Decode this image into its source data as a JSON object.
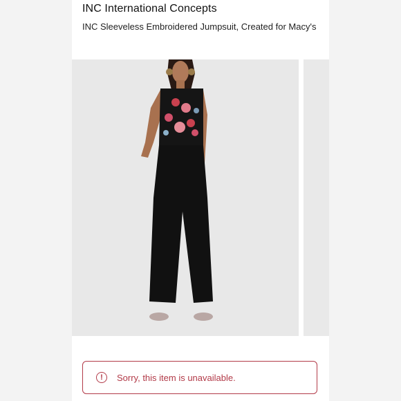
{
  "product": {
    "brand": "INC International Concepts",
    "title": "INC Sleeveless Embroidered Jumpsuit, Created for Macy's"
  },
  "gallery": {
    "image_description_icon": "product-photo-jumpsuit"
  },
  "notice": {
    "icon": "alert-circle-icon",
    "icon_glyph": "!",
    "message": "Sorry, this item is unavailable.",
    "color": "#b23a48"
  }
}
